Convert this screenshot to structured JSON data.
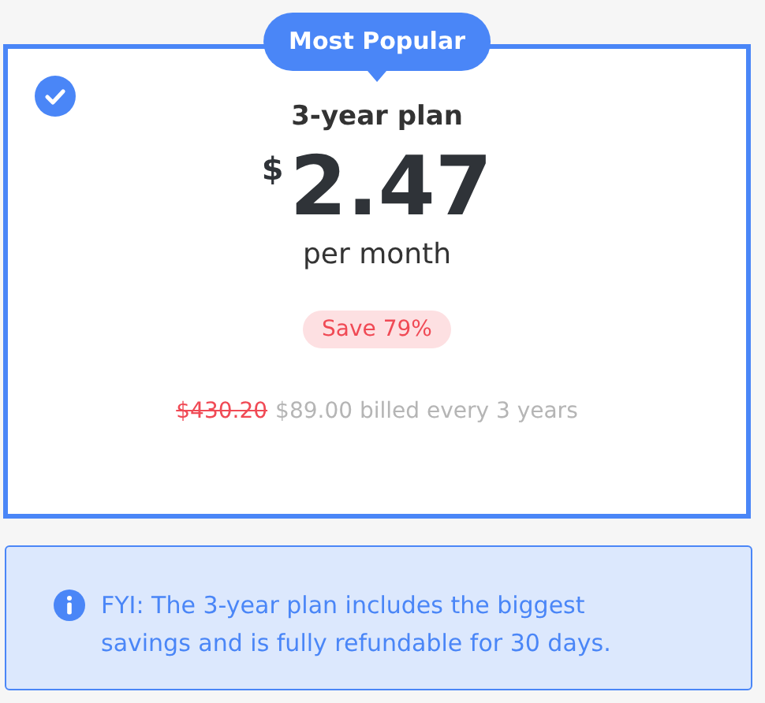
{
  "plan": {
    "badge": "Most Popular",
    "selected": true,
    "title": "3-year plan",
    "currency": "$",
    "price": "2.47",
    "period": "per month",
    "save": "Save 79%",
    "old_price": "$430.20",
    "billing": "$89.00 billed every 3 years"
  },
  "notice": {
    "text": "FYI: The 3-year plan includes the biggest savings and is fully refundable for 30 days."
  }
}
